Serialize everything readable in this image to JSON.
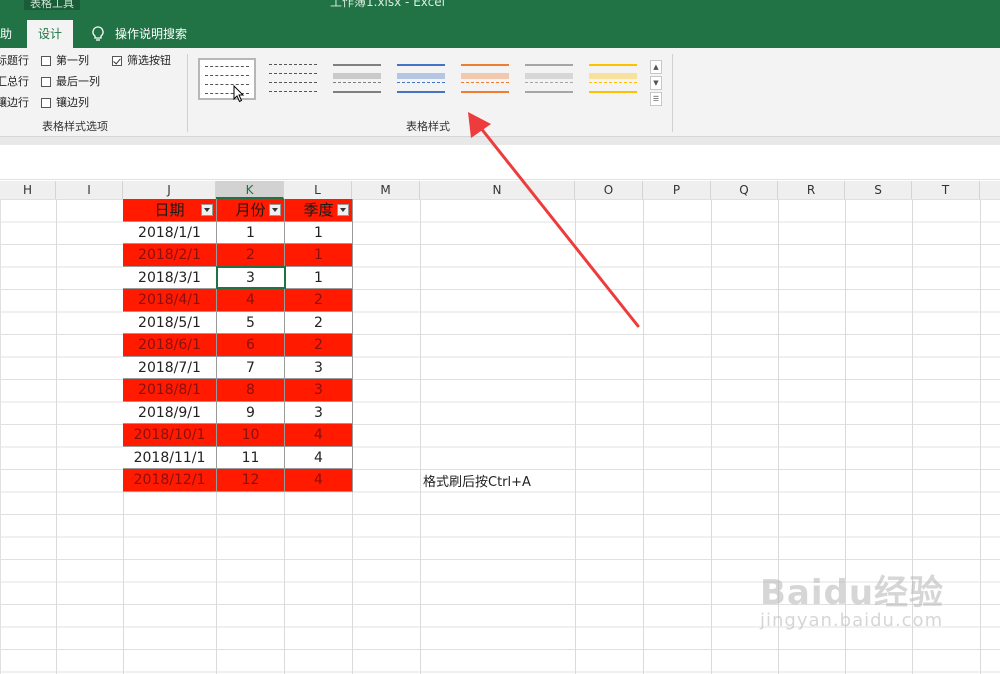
{
  "titlebar": {
    "context_label": "表格工具",
    "window_title": "工作簿1.xlsx  -  Excel",
    "tabs": {
      "help": "助",
      "design": "设计",
      "search": "操作说明搜索"
    }
  },
  "ribbon": {
    "options": {
      "header_row": "标题行",
      "total_row": "汇总行",
      "banded_rows": "镶边行",
      "first_column": "第一列",
      "last_column": "最后一列",
      "banded_columns": "镶边列",
      "filter_button": "筛选按钮"
    },
    "options_group_label": "表格样式选项",
    "styles_group_label": "表格样式",
    "style_colors": [
      "#ffffff",
      "#ffffff",
      "#7f7f7f",
      "#4472c4",
      "#ed7d31",
      "#a5a5a5",
      "#ffc000"
    ]
  },
  "columns": [
    "H",
    "I",
    "J",
    "K",
    "L",
    "M",
    "N",
    "O",
    "P",
    "Q",
    "R",
    "S",
    "T"
  ],
  "table": {
    "headers": [
      "日期",
      "月份",
      "季度"
    ],
    "rows": [
      [
        "2018/1/1",
        "1",
        "1"
      ],
      [
        "2018/2/1",
        "2",
        "1"
      ],
      [
        "2018/3/1",
        "3",
        "1"
      ],
      [
        "2018/4/1",
        "4",
        "2"
      ],
      [
        "2018/5/1",
        "5",
        "2"
      ],
      [
        "2018/6/1",
        "6",
        "2"
      ],
      [
        "2018/7/1",
        "7",
        "3"
      ],
      [
        "2018/8/1",
        "8",
        "3"
      ],
      [
        "2018/9/1",
        "9",
        "3"
      ],
      [
        "2018/10/1",
        "10",
        "4"
      ],
      [
        "2018/11/1",
        "11",
        "4"
      ],
      [
        "2018/12/1",
        "12",
        "4"
      ]
    ],
    "band_color": "#ff1a00"
  },
  "note": "格式刷后按Ctrl+A",
  "annotation_arrow_color": "#ee3b3b",
  "watermark": {
    "main": "Baidu经验",
    "sub": "jingyan.baidu.com"
  }
}
